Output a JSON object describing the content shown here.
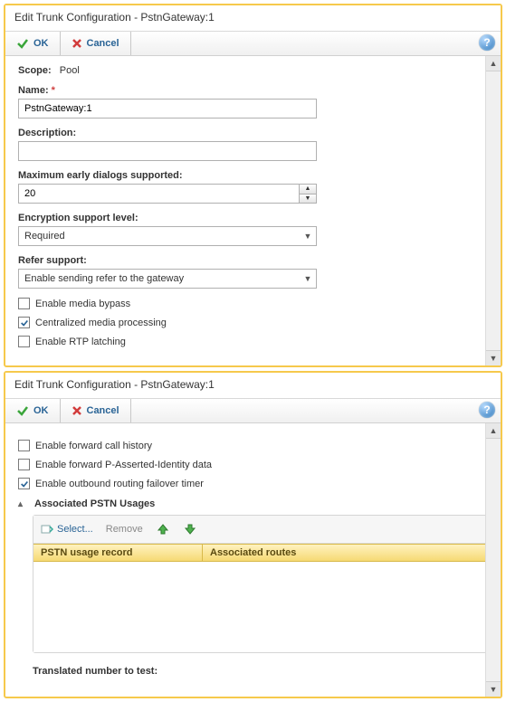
{
  "help_glyph": "?",
  "panel1": {
    "title": "Edit Trunk Configuration - PstnGateway:1",
    "toolbar": {
      "ok": "OK",
      "cancel": "Cancel"
    },
    "scope_label": "Scope:",
    "scope_value": "Pool",
    "name_label": "Name:",
    "name_value": "PstnGateway:1",
    "description_label": "Description:",
    "description_value": "",
    "max_dialogs_label": "Maximum early dialogs supported:",
    "max_dialogs_value": "20",
    "enc_label": "Encryption support level:",
    "enc_value": "Required",
    "refer_label": "Refer support:",
    "refer_value": "Enable sending refer to the gateway",
    "cb_media_bypass": "Enable media bypass",
    "cb_central": "Centralized media processing",
    "cb_rtp": "Enable RTP latching"
  },
  "panel2": {
    "title": "Edit Trunk Configuration - PstnGateway:1",
    "toolbar": {
      "ok": "OK",
      "cancel": "Cancel"
    },
    "cb_fwd_history": "Enable forward call history",
    "cb_fwd_pai": "Enable forward P-Asserted-Identity data",
    "cb_failover": "Enable outbound routing failover timer",
    "assoc_header": "Associated PSTN Usages",
    "subtoolbar": {
      "select": "Select...",
      "remove": "Remove"
    },
    "table": {
      "col_record": "PSTN usage record",
      "col_routes": "Associated routes"
    },
    "translated_label": "Translated number to test:"
  }
}
